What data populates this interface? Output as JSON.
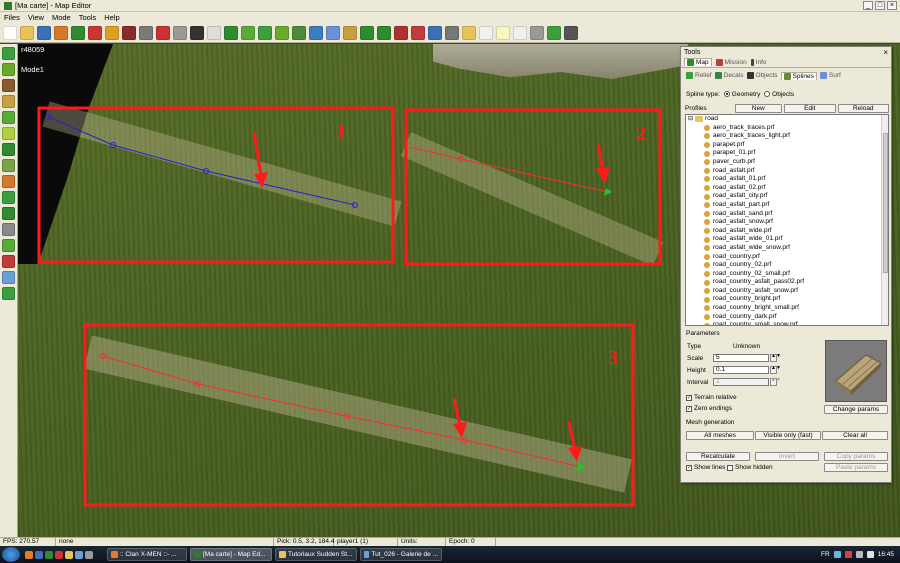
{
  "window": {
    "title": "[Ma carte] - Map Editor",
    "min": "_",
    "max": "□",
    "close": "×"
  },
  "menu": [
    "Files",
    "View",
    "Mode",
    "Tools",
    "Help"
  ],
  "viewport": {
    "build": "r48059",
    "mode": "Mode1"
  },
  "annotations": [
    "1",
    "2",
    "3"
  ],
  "tools_panel": {
    "title": "Tools",
    "close": "×",
    "tabs": [
      "Map",
      "Mission",
      "Info"
    ],
    "subtabs": [
      "Relief",
      "Decals",
      "Objects",
      "Splines",
      "Surf"
    ],
    "spline_type_label": "Spline type:",
    "spline_types": [
      "Geometry",
      "Objects"
    ],
    "profiles_label": "Profiles",
    "buttons": {
      "new": "New",
      "edit": "Edit",
      "reload": "Reload"
    },
    "tree_folder": "road",
    "profiles": [
      "aero_track_traces.prf",
      "aero_track_traces_light.prf",
      "parapet.prf",
      "parapet_01.prf",
      "paver_curb.prf",
      "road_asfalt.prf",
      "road_asfalt_01.prf",
      "road_asfalt_02.prf",
      "road_asfalt_city.prf",
      "road_asfalt_part.prf",
      "road_asfalt_sand.prf",
      "road_asfalt_snow.prf",
      "road_asfalt_wide.prf",
      "road_asfalt_wide_01.prf",
      "road_asfalt_wide_snow.prf",
      "road_country.prf",
      "road_country_02.prf",
      "road_country_02_small.prf",
      "road_country_asfalt_pass02.prf",
      "road_country_asfalt_snow.prf",
      "road_country_bright.prf",
      "road_country_bright_small.prf",
      "road_country_dark.prf",
      "road_country_small_snow.prf"
    ],
    "parameters": {
      "label": "Parameters",
      "type_label": "Type",
      "type_value": "Unknown",
      "scale_label": "Scale",
      "scale_value": "5",
      "height_label": "Height",
      "height_value": "0.1",
      "interval_label": "Interval",
      "interval_value": "1",
      "terrain_relative": "Terrain relative",
      "zero_endings": "Zero endings",
      "change_params": "Change params"
    },
    "mesh": {
      "label": "Mesh generation",
      "all": "All meshes",
      "visible": "Visible only (fast)",
      "clear": "Clear all"
    },
    "actions": {
      "recalculate": "Recalculate",
      "invert": "Invert",
      "copy": "Copy params",
      "paste": "Paste params"
    },
    "show_lines": "Show lines",
    "show_hidden": "Show hidden",
    "check": "✓"
  },
  "status": {
    "fps": "FPS: 270.57",
    "sel": "none",
    "pick": "Pick: 0.5, 3.2, 184.4",
    "player": "player1 (1)",
    "units": "Units:",
    "epoch": "Epoch: 0"
  },
  "taskbar": {
    "tasks": [
      ":: Clan X-MEN ::- ...",
      "[Ma carte] - Map Ed...",
      "Tutoriaux Sudden St...",
      "Tut_026 - Galerie de ..."
    ],
    "lang": "FR",
    "time": "16:45"
  },
  "colors": {
    "annotation": "#ff1a1a",
    "spline_selected": "#2020d0",
    "spline": "#ff2a2a",
    "endpoint": "#22c422"
  }
}
